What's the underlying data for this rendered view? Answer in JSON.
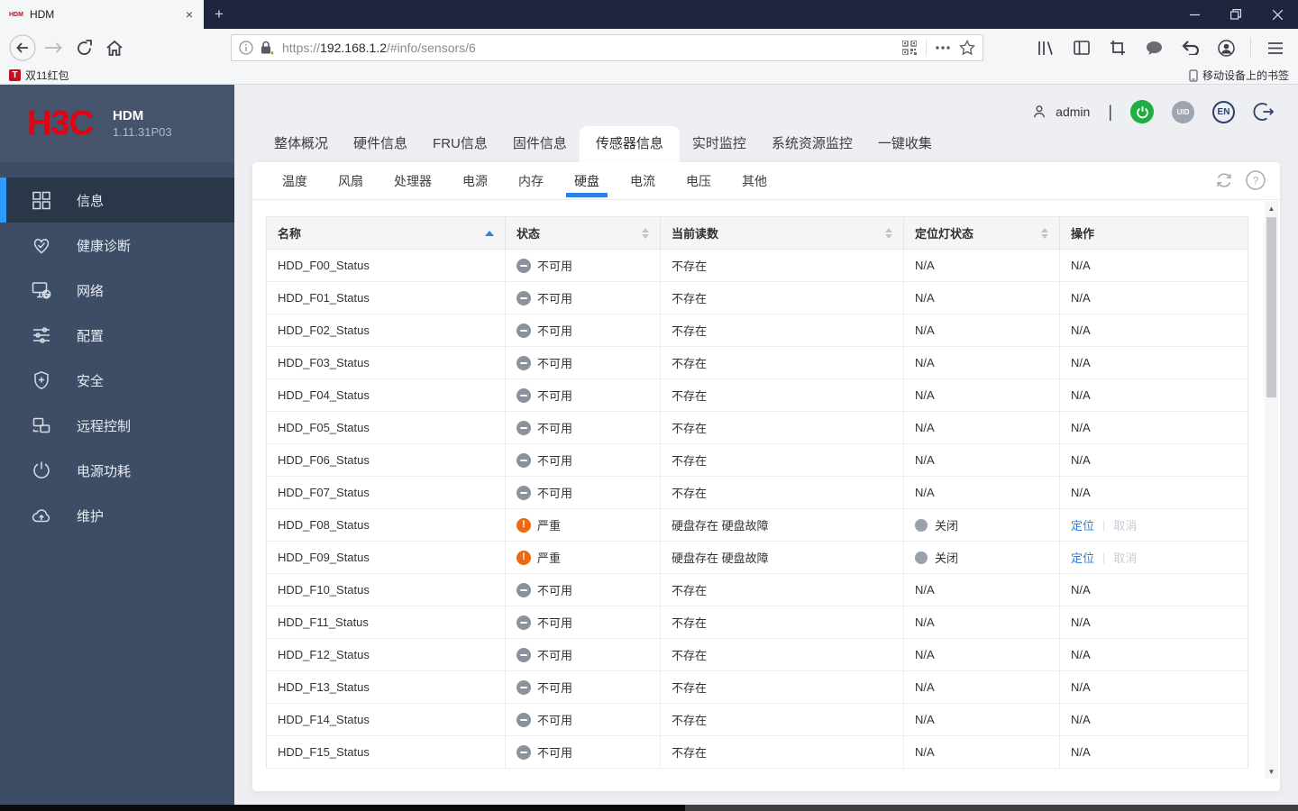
{
  "browser": {
    "tab_title": "HDM",
    "favicon_text": "HDM",
    "url": {
      "prefix": "https://",
      "host": "192.168.1.2",
      "path": "/#info/sensors/6"
    },
    "bookmark_label": "双11红包",
    "mobile_bookmarks_label": "移动设备上的书签"
  },
  "sidebar": {
    "logo": "H3C",
    "product": "HDM",
    "version": "1.11.31P03",
    "items": [
      {
        "label": "信息",
        "icon": "grid-icon",
        "active": true
      },
      {
        "label": "健康诊断",
        "icon": "heart-icon",
        "active": false
      },
      {
        "label": "网络",
        "icon": "network-icon",
        "active": false
      },
      {
        "label": "配置",
        "icon": "sliders-icon",
        "active": false
      },
      {
        "label": "安全",
        "icon": "shield-icon",
        "active": false
      },
      {
        "label": "远程控制",
        "icon": "remote-icon",
        "active": false
      },
      {
        "label": "电源功耗",
        "icon": "power-icon",
        "active": false
      },
      {
        "label": "维护",
        "icon": "cloud-icon",
        "active": false
      }
    ]
  },
  "header": {
    "username": "admin",
    "uid_label": "UID",
    "lang_label": "EN"
  },
  "tabs": {
    "items": [
      "整体概况",
      "硬件信息",
      "FRU信息",
      "固件信息",
      "传感器信息",
      "实时监控",
      "系统资源监控",
      "一键收集"
    ],
    "active_index": 4
  },
  "subtabs": {
    "items": [
      "温度",
      "风扇",
      "处理器",
      "电源",
      "内存",
      "硬盘",
      "电流",
      "电压",
      "其他"
    ],
    "active_index": 5
  },
  "table": {
    "columns": [
      {
        "label": "名称",
        "sort": "asc"
      },
      {
        "label": "状态",
        "sort": "both"
      },
      {
        "label": "当前读数",
        "sort": "both"
      },
      {
        "label": "定位灯状态",
        "sort": "both"
      },
      {
        "label": "操作",
        "sort": "none"
      }
    ],
    "op_labels": {
      "locate": "定位",
      "cancel": "取消",
      "na": "N/A"
    },
    "rows": [
      {
        "name": "HDD_F00_Status",
        "status": "unavailable",
        "status_text": "不可用",
        "reading": "不存在",
        "led": "na",
        "led_text": "N/A",
        "op": "na"
      },
      {
        "name": "HDD_F01_Status",
        "status": "unavailable",
        "status_text": "不可用",
        "reading": "不存在",
        "led": "na",
        "led_text": "N/A",
        "op": "na"
      },
      {
        "name": "HDD_F02_Status",
        "status": "unavailable",
        "status_text": "不可用",
        "reading": "不存在",
        "led": "na",
        "led_text": "N/A",
        "op": "na"
      },
      {
        "name": "HDD_F03_Status",
        "status": "unavailable",
        "status_text": "不可用",
        "reading": "不存在",
        "led": "na",
        "led_text": "N/A",
        "op": "na"
      },
      {
        "name": "HDD_F04_Status",
        "status": "unavailable",
        "status_text": "不可用",
        "reading": "不存在",
        "led": "na",
        "led_text": "N/A",
        "op": "na"
      },
      {
        "name": "HDD_F05_Status",
        "status": "unavailable",
        "status_text": "不可用",
        "reading": "不存在",
        "led": "na",
        "led_text": "N/A",
        "op": "na"
      },
      {
        "name": "HDD_F06_Status",
        "status": "unavailable",
        "status_text": "不可用",
        "reading": "不存在",
        "led": "na",
        "led_text": "N/A",
        "op": "na"
      },
      {
        "name": "HDD_F07_Status",
        "status": "unavailable",
        "status_text": "不可用",
        "reading": "不存在",
        "led": "na",
        "led_text": "N/A",
        "op": "na"
      },
      {
        "name": "HDD_F08_Status",
        "status": "critical",
        "status_text": "严重",
        "reading": "硬盘存在 硬盘故障",
        "led": "off",
        "led_text": "关闭",
        "op": "locate"
      },
      {
        "name": "HDD_F09_Status",
        "status": "critical",
        "status_text": "严重",
        "reading": "硬盘存在 硬盘故障",
        "led": "off",
        "led_text": "关闭",
        "op": "locate"
      },
      {
        "name": "HDD_F10_Status",
        "status": "unavailable",
        "status_text": "不可用",
        "reading": "不存在",
        "led": "na",
        "led_text": "N/A",
        "op": "na"
      },
      {
        "name": "HDD_F11_Status",
        "status": "unavailable",
        "status_text": "不可用",
        "reading": "不存在",
        "led": "na",
        "led_text": "N/A",
        "op": "na"
      },
      {
        "name": "HDD_F12_Status",
        "status": "unavailable",
        "status_text": "不可用",
        "reading": "不存在",
        "led": "na",
        "led_text": "N/A",
        "op": "na"
      },
      {
        "name": "HDD_F13_Status",
        "status": "unavailable",
        "status_text": "不可用",
        "reading": "不存在",
        "led": "na",
        "led_text": "N/A",
        "op": "na"
      },
      {
        "name": "HDD_F14_Status",
        "status": "unavailable",
        "status_text": "不可用",
        "reading": "不存在",
        "led": "na",
        "led_text": "N/A",
        "op": "na"
      },
      {
        "name": "HDD_F15_Status",
        "status": "unavailable",
        "status_text": "不可用",
        "reading": "不存在",
        "led": "na",
        "led_text": "N/A",
        "op": "na"
      }
    ]
  },
  "colors": {
    "accent_blue": "#2F9BFE",
    "tab_underline": "#2A82E4",
    "link_blue": "#2A7DE1",
    "critical_orange": "#F0690D",
    "power_green": "#1EAE41",
    "sidebar_bg": "#3E4D66",
    "sidebar_selected": "#2A3748",
    "titlebar_bg": "#20243F",
    "logo_red": "#E60014"
  }
}
